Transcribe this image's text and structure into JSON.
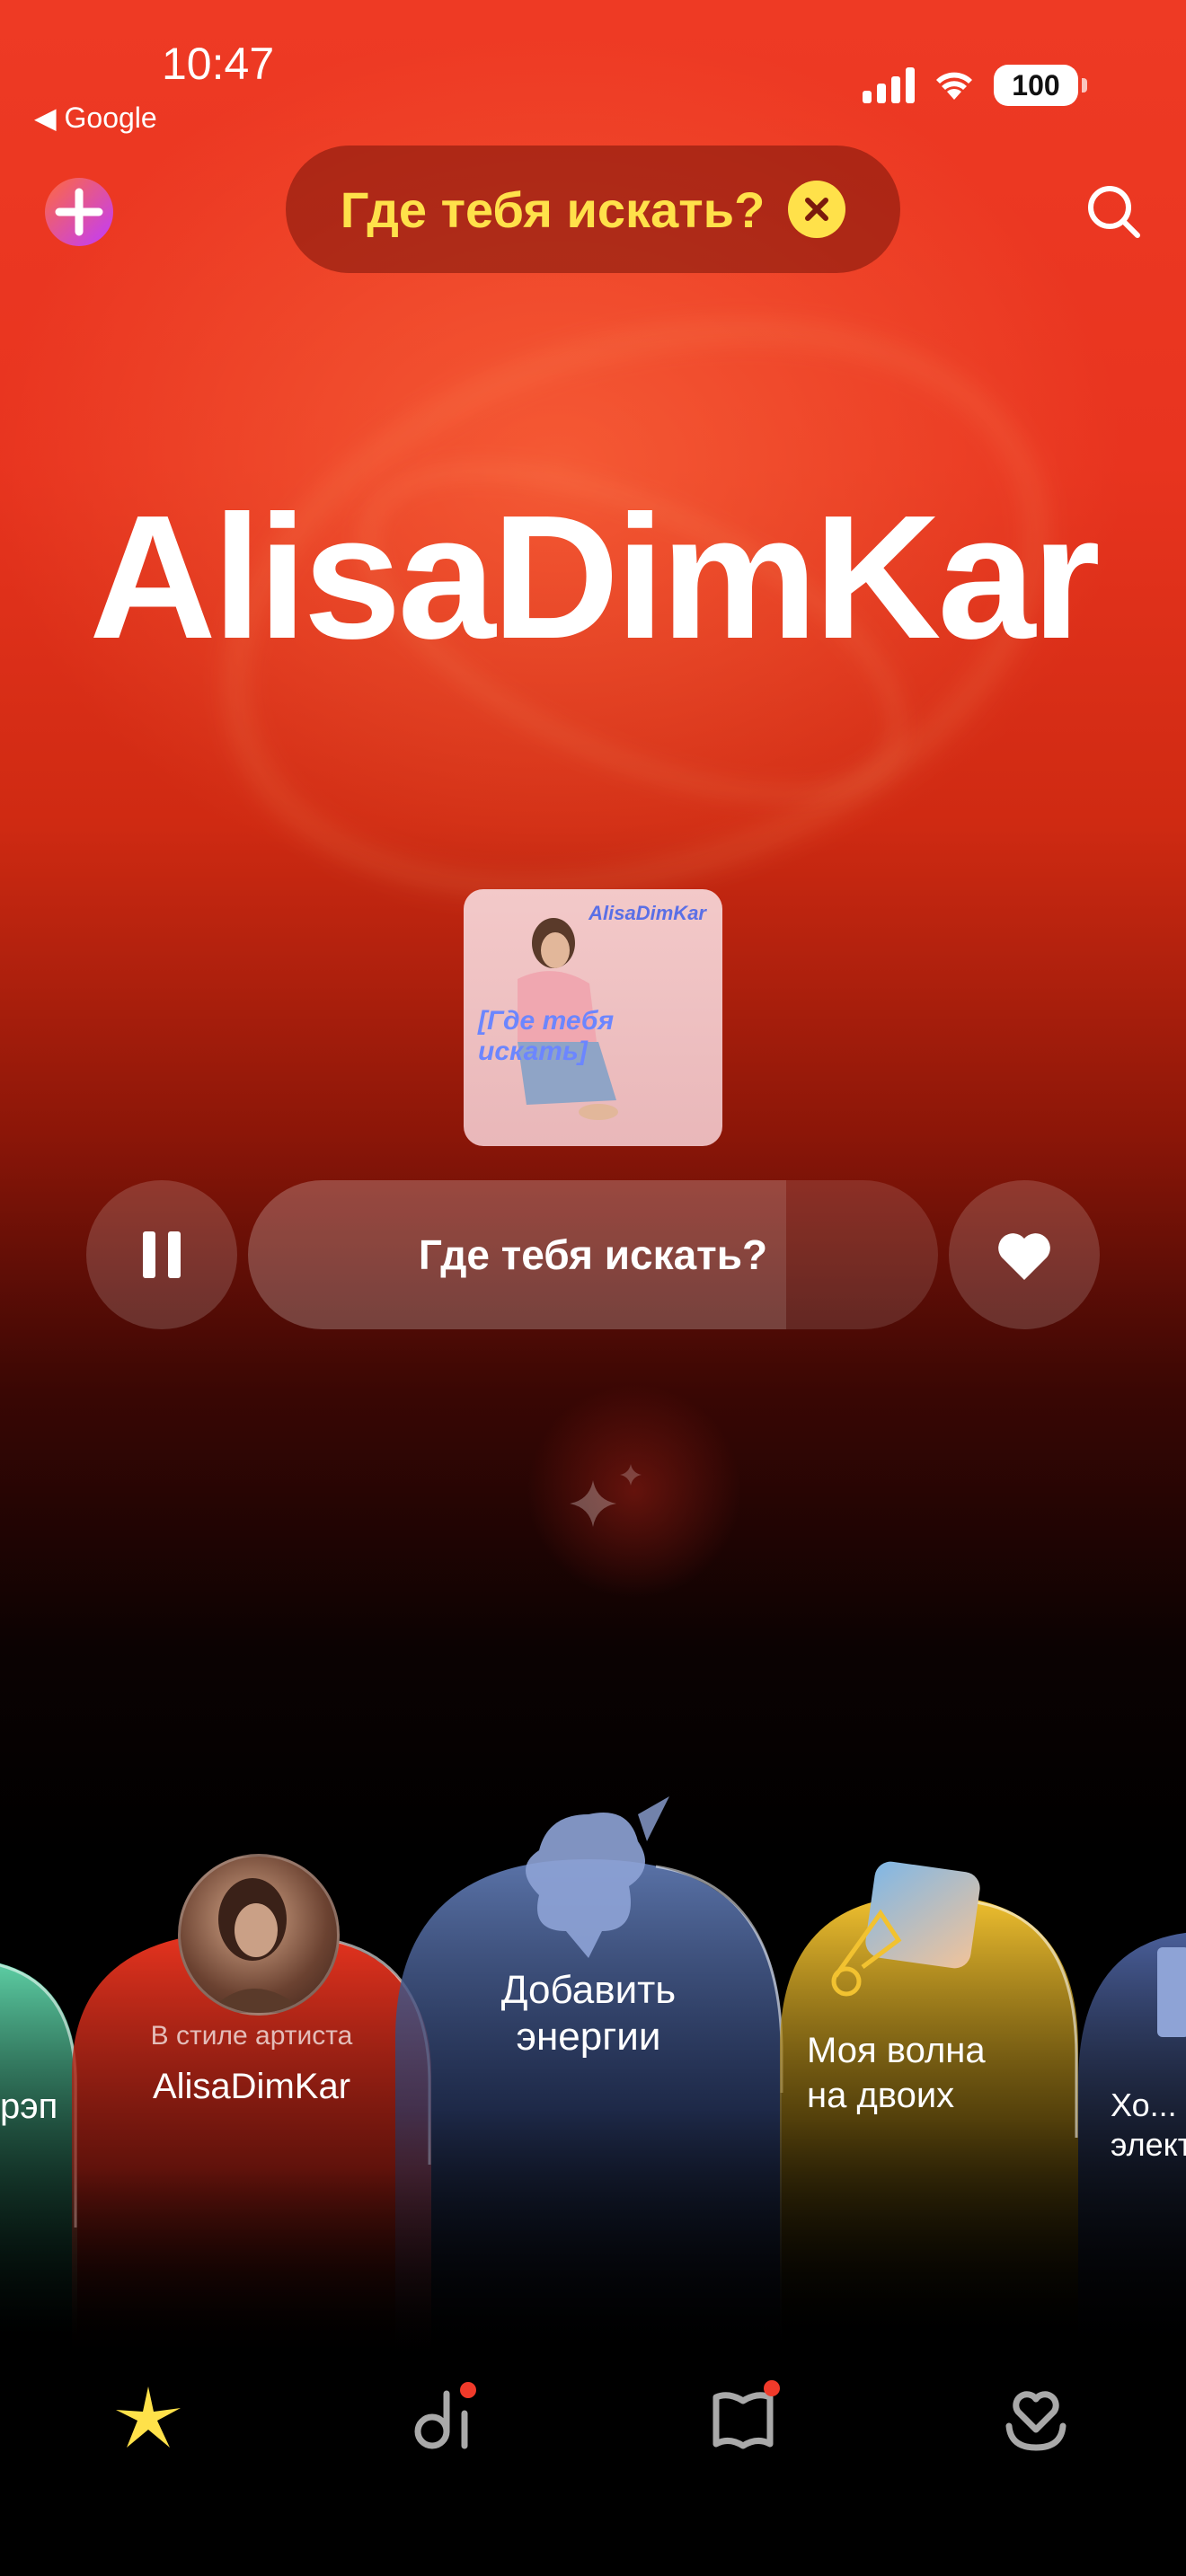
{
  "status_bar": {
    "time": "10:47",
    "back_app": "◀ Google",
    "battery": "100"
  },
  "top_bar": {
    "plus_icon": "plus-icon",
    "now_playing_chip": "Где тебя искать?",
    "close_icon": "close-circle-icon",
    "search_icon": "search-icon"
  },
  "header": {
    "artist_name": "AlisaDimKar"
  },
  "cover": {
    "top_text": "AlisaDimKar",
    "title_text": "[Где тебя искать]"
  },
  "player": {
    "track_title": "Где тебя искать?",
    "progress": 0.78,
    "pause_icon": "pause-icon",
    "like_icon": "heart-icon"
  },
  "waves": [
    {
      "label": "рэп",
      "color": "#3fbf8e"
    },
    {
      "subtitle": "В стиле артиста",
      "label": "AlisaDimKar",
      "color": "#e8341f"
    },
    {
      "label": "Добавить энергии",
      "color": "#5a73a8"
    },
    {
      "label": "Моя волна на двоих",
      "color": "#f2c230"
    },
    {
      "label": "Хо... элект...",
      "color": "#4a5f9a"
    }
  ],
  "tabbar": {
    "tabs": [
      {
        "name": "main",
        "icon": "sparkle-icon"
      },
      {
        "name": "podcasts",
        "icon": "podcast-icon"
      },
      {
        "name": "books",
        "icon": "book-icon"
      },
      {
        "name": "collection",
        "icon": "heart-collection-icon"
      }
    ]
  },
  "colors": {
    "accent_yellow": "#ffe14a",
    "background_red": "#e8341f",
    "notification_dot": "#f03a2a"
  }
}
